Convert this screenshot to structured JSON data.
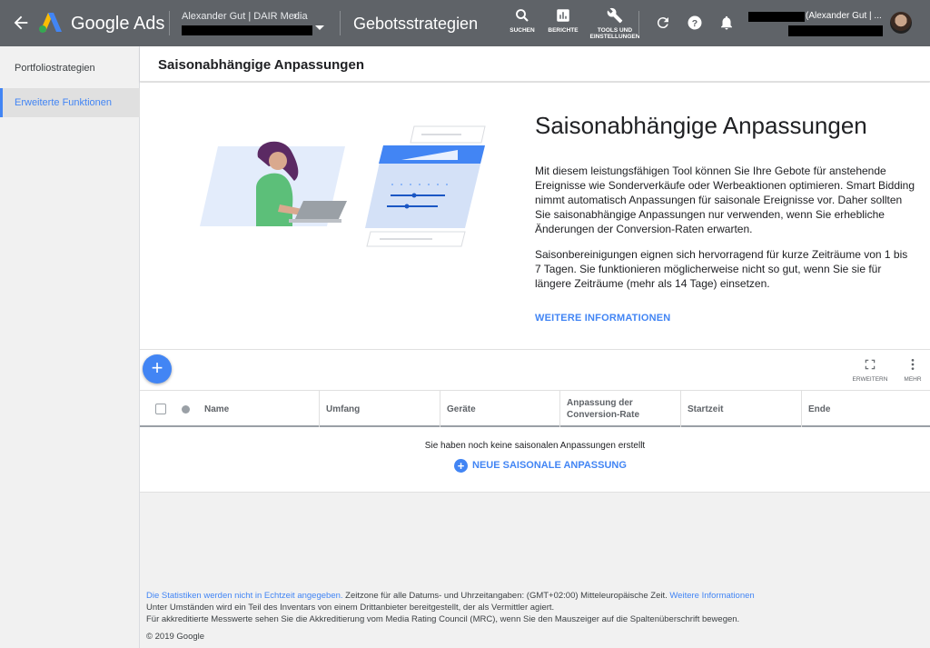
{
  "topbar": {
    "brand": "Google Ads",
    "account_name": "Alexander Gut | DAIR Media",
    "page_title": "Gebotsstrategien",
    "tools": [
      {
        "label": "SUCHEN",
        "icon": "search-icon"
      },
      {
        "label": "BERICHTE",
        "icon": "reports-icon"
      },
      {
        "label": "TOOLS UND EINSTELLUNGEN",
        "icon": "wrench-icon"
      }
    ],
    "user_text": "(Alexander Gut | ..."
  },
  "sidebar": {
    "items": [
      {
        "label": "Portfoliostrategien",
        "active": false
      },
      {
        "label": "Erweiterte Funktionen",
        "active": true
      }
    ]
  },
  "section": {
    "title": "Saisonabhängige Anpassungen"
  },
  "hero": {
    "title": "Saisonabhängige Anpassungen",
    "p1": "Mit diesem leistungsfähigen Tool können Sie Ihre Gebote für anstehende Ereignisse wie Sonderverkäufe oder Werbeaktionen optimieren. Smart Bidding nimmt automatisch Anpassungen für saisonale Ereignisse vor. Daher sollten Sie saisonabhängige Anpassungen nur verwenden, wenn Sie erhebliche Änderungen der Conversion-Raten erwarten.",
    "p2": "Saisonbereinigungen eignen sich hervorragend für kurze Zeiträume von 1 bis 7 Tagen. Sie funktionieren möglicherweise nicht so gut, wenn Sie sie für längere Zeiträume (mehr als 14 Tage) einsetzen.",
    "link": "WEITERE INFORMATIONEN"
  },
  "toolbar": {
    "expand_label": "ERWEITERN",
    "more_label": "MEHR"
  },
  "table": {
    "columns": [
      "Name",
      "Umfang",
      "Geräte",
      "Anpassung der Conversion-Rate",
      "Startzeit",
      "Ende"
    ],
    "empty_message": "Sie haben noch keine saisonalen Anpassungen erstellt",
    "new_button": "NEUE SAISONALE ANPASSUNG"
  },
  "footer": {
    "stats_link": "Die Statistiken werden nicht in Echtzeit angegeben.",
    "timezone_text": " Zeitzone für alle Datums- und Uhrzeitangaben: (GMT+02:00) Mitteleuropäische Zeit. ",
    "more_link": "Weitere Informationen",
    "line2": "Unter Umständen wird ein Teil des Inventars von einem Drittanbieter bereitgestellt, der als Vermittler agiert.",
    "line3": "Für akkreditierte Messwerte sehen Sie die Akkreditierung vom Media Rating Council (MRC), wenn Sie den Mauszeiger auf die Spaltenüberschrift bewegen.",
    "copyright": "© 2019 Google"
  },
  "colors": {
    "topbar": "#5f6368",
    "accent": "#4285f4"
  }
}
